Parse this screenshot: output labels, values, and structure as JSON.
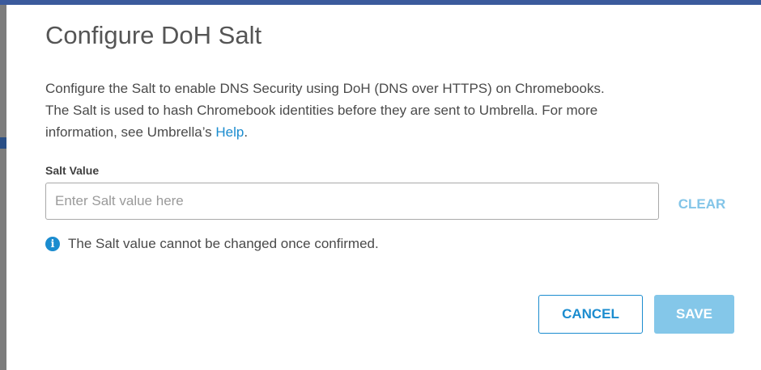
{
  "dialog": {
    "title": "Configure DoH Salt",
    "description_line1": "Configure the Salt to enable DNS Security using DoH (DNS over HTTPS) on Chromebooks.",
    "description_line2": "The Salt is used to hash Chromebook identities before they are sent to Umbrella. For more",
    "description_line3_prefix": "information, see Umbrella’s ",
    "help_link": "Help",
    "description_line3_suffix": "."
  },
  "salt_field": {
    "label": "Salt Value",
    "value": "",
    "placeholder": "Enter Salt value here",
    "clear_label": "CLEAR"
  },
  "info": {
    "icon": "info-icon",
    "glyph": "i",
    "text": "The Salt value cannot be changed once confirmed."
  },
  "actions": {
    "cancel_label": "CANCEL",
    "save_label": "SAVE"
  },
  "colors": {
    "accent": "#1b8ccf",
    "disabled_accent": "#84c7e9",
    "header_strip": "#3b5a9c",
    "text": "#4a4a4a"
  }
}
